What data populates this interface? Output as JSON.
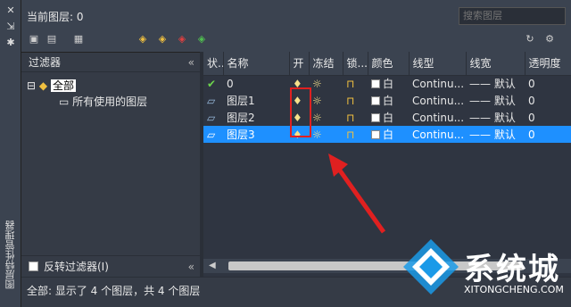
{
  "side_title": "图层特性管理器",
  "current_layer": "当前图层: 0",
  "search_placeholder": "搜索图层",
  "filter_header": "过滤器",
  "tree": {
    "root": "全部",
    "child": "所有使用的图层"
  },
  "invert_filter": "反转过滤器(I)",
  "columns": [
    "状...",
    "名称",
    "开",
    "冻结",
    "锁...",
    "颜色",
    "线型",
    "线宽",
    "透明度"
  ],
  "rows": [
    {
      "name": "0",
      "color": "白",
      "linetype": "Continu...",
      "lineweight": "默认",
      "transparency": "0"
    },
    {
      "name": "图层1",
      "color": "白",
      "linetype": "Continu...",
      "lineweight": "默认",
      "transparency": "0"
    },
    {
      "name": "图层2",
      "color": "白",
      "linetype": "Continu...",
      "lineweight": "默认",
      "transparency": "0"
    },
    {
      "name": "图层3",
      "color": "白",
      "linetype": "Continu...",
      "lineweight": "默认",
      "transparency": "0"
    }
  ],
  "status": "全部: 显示了 4 个图层，共 4 个图层",
  "watermark": {
    "cn": "系统城",
    "en": "XITONGCHENG.COM"
  }
}
